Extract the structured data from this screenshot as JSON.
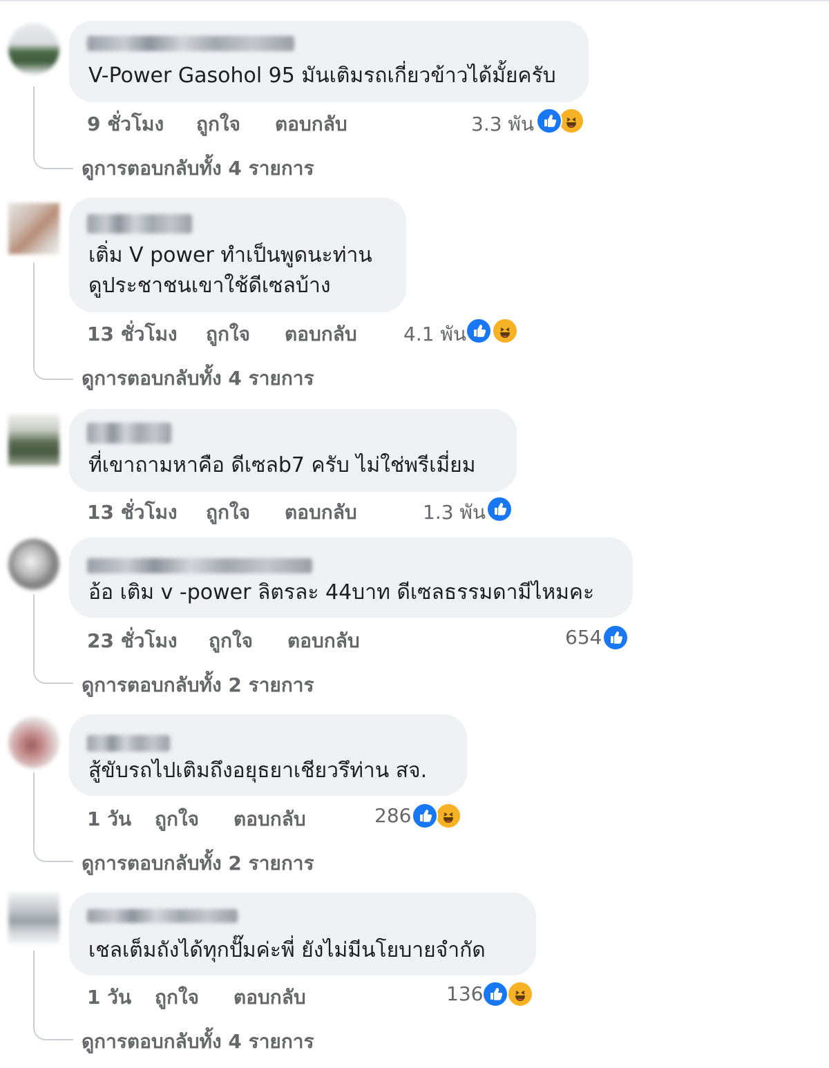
{
  "labels": {
    "like": "ถูกใจ",
    "reply": "ตอบกลับ"
  },
  "colors": {
    "like": "#1877f2",
    "haha": "#f7b125",
    "bubble": "#eff1f4",
    "meta": "#65676b"
  },
  "comments": [
    {
      "text_lines": [
        "V-Power Gasohol 95 มันเติมรถเกี่ยวข้าวได้มั้ยครับ"
      ],
      "time": "9 ชั่วโมง",
      "reaction_count": "3.3 พัน",
      "reactions": [
        "like-icon",
        "haha-icon"
      ],
      "view_replies": "ดูการตอบกลับทั้ง 4 รายการ"
    },
    {
      "text_lines": [
        "เติ่ม V power ทำเป็นพูดนะท่าน",
        "ดูประชาชนเขาใช้ดีเซลบ้าง"
      ],
      "time": "13 ชั่วโมง",
      "reaction_count": "4.1 พัน",
      "reactions": [
        "like-icon",
        "haha-icon"
      ],
      "view_replies": "ดูการตอบกลับทั้ง 4 รายการ"
    },
    {
      "text_lines": [
        "ที่เขาถามหาคือ ดีเซลb7 ครับ ไม่ใช่พรีเมี่ยม"
      ],
      "time": "13 ชั่วโมง",
      "reaction_count": "1.3 พัน",
      "reactions": [
        "like-icon"
      ],
      "view_replies": ""
    },
    {
      "text_lines": [
        "อ้อ เติม v -power ลิตรละ 44บาท ดีเซลธรรมดามีไหมคะ"
      ],
      "time": "23 ชั่วโมง",
      "reaction_count": "654",
      "reactions": [
        "like-icon"
      ],
      "view_replies": "ดูการตอบกลับทั้ง 2 รายการ"
    },
    {
      "text_lines": [
        "สู้ขับรถไปเติมถึงอยุธยาเชียวรึท่าน สจ."
      ],
      "time": "1 วัน",
      "reaction_count": "286",
      "reactions": [
        "like-icon",
        "haha-icon"
      ],
      "view_replies": "ดูการตอบกลับทั้ง 2 รายการ"
    },
    {
      "text_lines": [
        "เชลเต็มถังได้ทุกปั๊มค่ะพี่ ยังไม่มีนโยบายจำกัด"
      ],
      "time": "1 วัน",
      "reaction_count": "136",
      "reactions": [
        "like-icon",
        "haha-icon"
      ],
      "view_replies": "ดูการตอบกลับทั้ง 4 รายการ"
    }
  ]
}
